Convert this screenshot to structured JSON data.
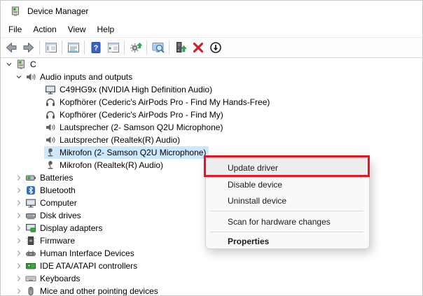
{
  "window": {
    "title": "Device Manager"
  },
  "menubar": {
    "items": [
      {
        "label": "File"
      },
      {
        "label": "Action"
      },
      {
        "label": "View"
      },
      {
        "label": "Help"
      }
    ]
  },
  "toolbar": {
    "buttons": [
      {
        "name": "back-button",
        "icon": "back-arrow-icon"
      },
      {
        "name": "forward-button",
        "icon": "forward-arrow-icon"
      },
      {
        "separator": true
      },
      {
        "name": "show-console-tree-button",
        "icon": "console-tree-icon"
      },
      {
        "separator": true
      },
      {
        "name": "properties-button",
        "icon": "properties-window-icon"
      },
      {
        "separator": true
      },
      {
        "name": "help-button",
        "icon": "help-icon"
      },
      {
        "name": "action-pane-button",
        "icon": "action-pane-icon"
      },
      {
        "separator": true
      },
      {
        "name": "update-driver-toolbar-button",
        "icon": "gear-update-icon"
      },
      {
        "separator": true
      },
      {
        "name": "scan-hardware-button",
        "icon": "scan-hardware-icon"
      },
      {
        "separator": true
      },
      {
        "name": "update-device-driver-button",
        "icon": "device-update-icon"
      },
      {
        "name": "uninstall-device-toolbar-button",
        "icon": "uninstall-x-icon"
      },
      {
        "name": "disable-device-toolbar-button",
        "icon": "disable-circle-icon"
      }
    ]
  },
  "tree": {
    "items": [
      {
        "level": 0,
        "state": "expanded",
        "icon": "device-manager-icon",
        "label": "C"
      },
      {
        "level": 1,
        "state": "expanded",
        "icon": "audio-device-icon",
        "label": "Audio inputs and outputs"
      },
      {
        "level": 2,
        "icon": "monitor-icon",
        "label": "C49HG9x (NVIDIA High Definition Audio)"
      },
      {
        "level": 2,
        "icon": "headphones-icon",
        "label": "Kopfhörer (Cederic's AirPods Pro - Find My Hands-Free)"
      },
      {
        "level": 2,
        "icon": "headphones-icon",
        "label": "Kopfhörer (Cederic's AirPods Pro - Find My)"
      },
      {
        "level": 2,
        "icon": "speaker-icon",
        "label": "Lautsprecher (2- Samson Q2U Microphone)"
      },
      {
        "level": 2,
        "icon": "speaker-icon",
        "label": "Lautsprecher (Realtek(R) Audio)"
      },
      {
        "level": 2,
        "icon": "microphone-icon",
        "label": "Mikrofon (2- Samson Q2U Microphone)",
        "selected": true
      },
      {
        "level": 2,
        "icon": "microphone-icon",
        "label": "Mikrofon (Realtek(R) Audio)"
      },
      {
        "level": 1,
        "state": "collapsed",
        "icon": "battery-icon",
        "label": "Batteries"
      },
      {
        "level": 1,
        "state": "collapsed",
        "icon": "bluetooth-icon",
        "label": "Bluetooth"
      },
      {
        "level": 1,
        "state": "collapsed",
        "icon": "computer-icon",
        "label": "Computer"
      },
      {
        "level": 1,
        "state": "collapsed",
        "icon": "disk-drive-icon",
        "label": "Disk drives"
      },
      {
        "level": 1,
        "state": "collapsed",
        "icon": "display-adapter-icon",
        "label": "Display adapters"
      },
      {
        "level": 1,
        "state": "collapsed",
        "icon": "firmware-chip-icon",
        "label": "Firmware"
      },
      {
        "level": 1,
        "state": "collapsed",
        "icon": "hid-icon",
        "label": "Human Interface Devices"
      },
      {
        "level": 1,
        "state": "collapsed",
        "icon": "ide-controller-icon",
        "label": "IDE ATA/ATAPI controllers"
      },
      {
        "level": 1,
        "state": "collapsed",
        "icon": "keyboard-icon",
        "label": "Keyboards"
      },
      {
        "level": 1,
        "state": "collapsed",
        "icon": "mouse-icon",
        "label": "Mice and other pointing devices"
      }
    ]
  },
  "context_menu": {
    "items": [
      {
        "label": "Update driver",
        "hover": true,
        "annotated": true
      },
      {
        "label": "Disable device"
      },
      {
        "label": "Uninstall device"
      },
      {
        "separator": true
      },
      {
        "label": "Scan for hardware changes"
      },
      {
        "separator": true
      },
      {
        "label": "Properties",
        "bold": true
      }
    ]
  },
  "annotation": {
    "color": "#e81224"
  },
  "colors": {
    "selection": "#cce8ff",
    "menu_bg": "#f9f9f9",
    "annotation_red": "#e81224"
  }
}
